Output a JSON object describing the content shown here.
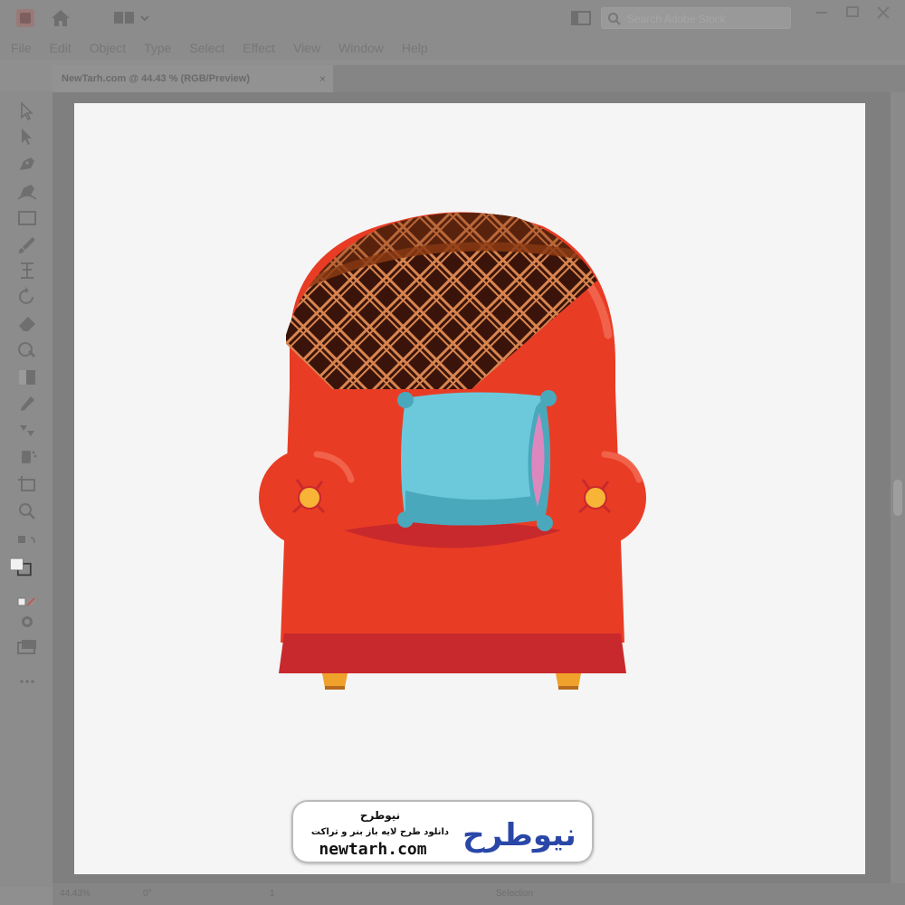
{
  "menubar": {
    "items": [
      "File",
      "Edit",
      "Object",
      "Type",
      "Select",
      "Effect",
      "View",
      "Window",
      "Help"
    ]
  },
  "search": {
    "placeholder": "Search Adobe Stock"
  },
  "tab": {
    "title": "NewTarh.com @ 44.43 % (RGB/Preview)",
    "close": "×"
  },
  "status": {
    "zoom": "44.43%",
    "rotation": "0°",
    "page": "1",
    "tool": "Selection"
  },
  "watermark": {
    "logo_text": "نیوطرح",
    "name": "نیوطرح",
    "tagline": "دانلود طرح لایه باز بنر و تراکت",
    "url": "newtarh.com"
  },
  "colors": {
    "chair_red": "#e93c25",
    "chair_dark_red": "#c8292c",
    "blanket_brown": "#8b3a13",
    "blanket_dark": "#3a140a",
    "plaid_line": "#d98550",
    "pillow_blue": "#6cc9dc",
    "pillow_shadow": "#4aa8bc",
    "pillow_pink": "#dd87bf",
    "button_yellow": "#f8b437",
    "leg_orange": "#f0a12c",
    "logo_blue": "#2a47a8",
    "logo_red": "#e02b23"
  },
  "icons": {
    "app": "illustrator-logo-icon",
    "home": "home-icon",
    "workspace": "workspace-layout-icon",
    "search": "search-icon",
    "window": [
      "minimize-icon",
      "restore-icon",
      "close-icon"
    ],
    "tools": [
      "selection-tool-icon",
      "direct-selection-tool-icon",
      "pen-tool-icon",
      "curvature-tool-icon",
      "rectangle-tool-icon",
      "brush-tool-icon",
      "type-tool-icon",
      "rotate-tool-icon",
      "eraser-tool-icon",
      "shape-builder-tool-icon",
      "gradient-tool-icon",
      "eyedropper-tool-icon",
      "blend-tool-icon",
      "symbol-sprayer-tool-icon",
      "artboard-tool-icon",
      "zoom-tool-icon"
    ]
  }
}
